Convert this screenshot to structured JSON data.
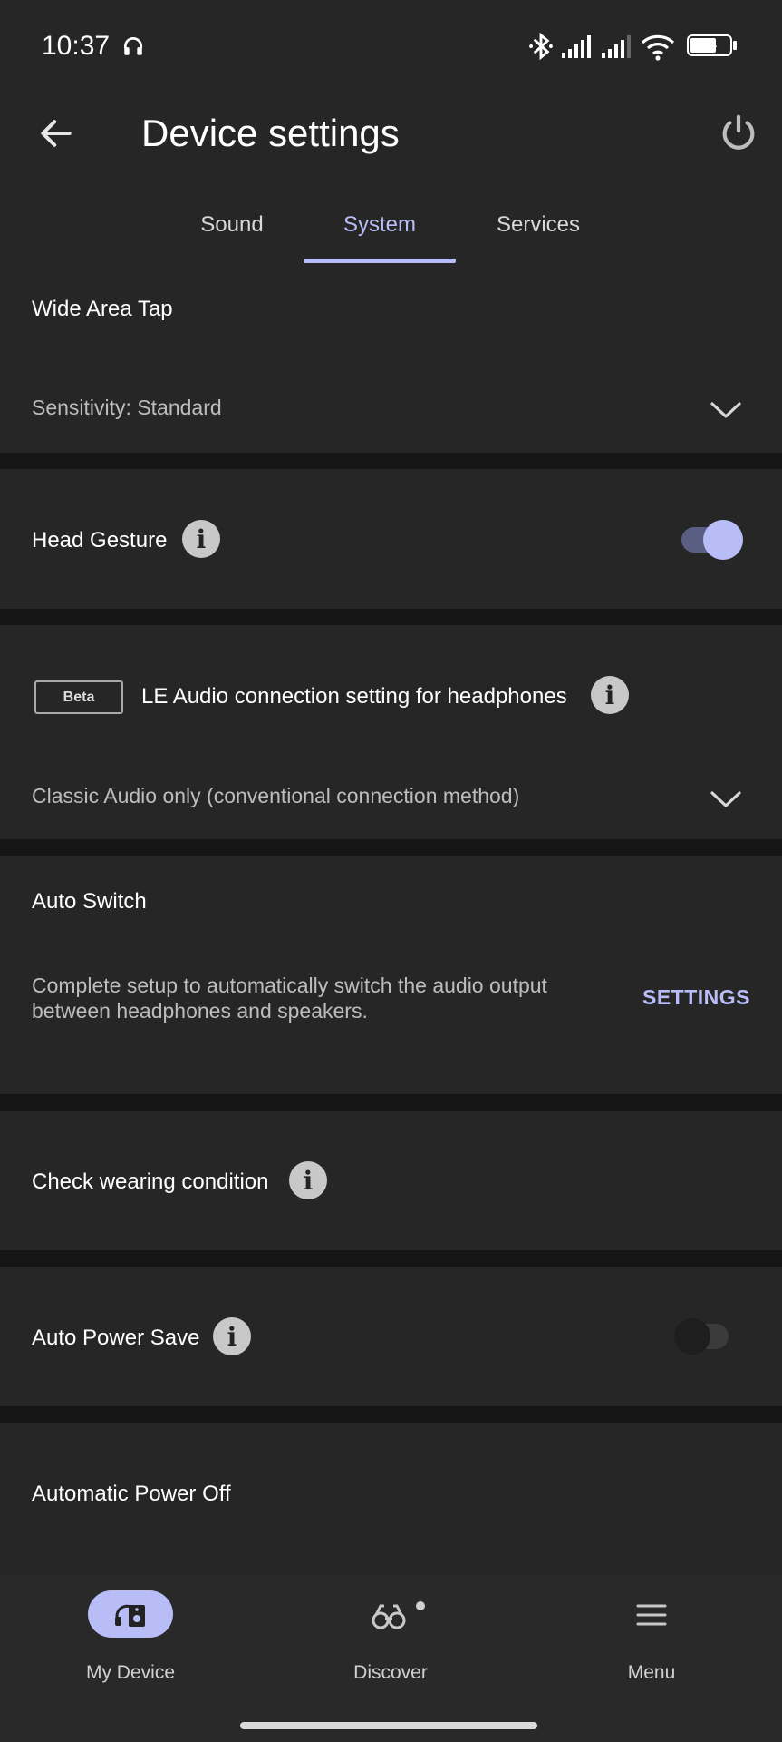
{
  "status_bar": {
    "time": "10:37",
    "battery": "64"
  },
  "app_bar": {
    "title": "Device settings"
  },
  "tabs": [
    {
      "label": "Sound"
    },
    {
      "label": "System"
    },
    {
      "label": "Services"
    }
  ],
  "active_tab": "System",
  "sections": {
    "wide_area_tap": {
      "title": "Wide Area Tap",
      "value": "Sensitivity: Standard"
    },
    "head_gesture": {
      "title": "Head Gesture",
      "enabled": true
    },
    "le_audio": {
      "badge": "Beta",
      "title": "LE Audio connection setting for headphones",
      "value": "Classic Audio only (conventional connection method)"
    },
    "auto_switch": {
      "title": "Auto Switch",
      "description_line1": "Complete setup to automatically switch the audio output",
      "description_line2": "between headphones and speakers.",
      "button": "SETTINGS"
    },
    "check_wearing": {
      "title": "Check wearing condition"
    },
    "auto_power_save": {
      "title": "Auto Power Save",
      "enabled": false
    },
    "auto_power_off": {
      "title": "Automatic Power Off"
    }
  },
  "bottom_nav": [
    {
      "label": "My Device",
      "icon": "headphones-speaker-icon",
      "active": true
    },
    {
      "label": "Discover",
      "icon": "binoculars-icon"
    },
    {
      "label": "Menu",
      "icon": "menu-icon"
    }
  ],
  "colors": {
    "accent": "#b9bdf7",
    "card": "#262626",
    "background": "#151515"
  }
}
